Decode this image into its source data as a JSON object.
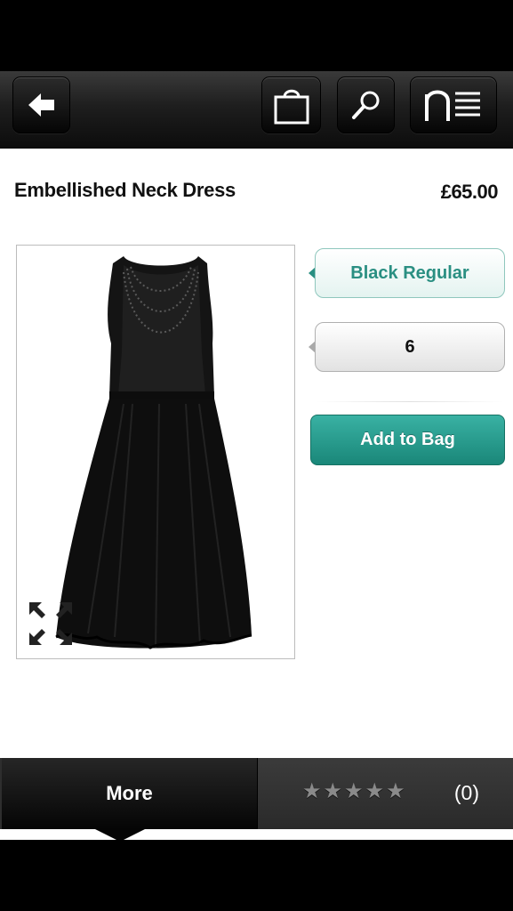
{
  "toolbar": {
    "back_icon": "arrow-left-icon",
    "bag_icon": "shopping-bag-icon",
    "search_icon": "magnifier-icon",
    "menu_icon": "brand-menu-icon",
    "menu_logo": "n"
  },
  "product": {
    "title": "Embellished Neck Dress",
    "price": "£65.00",
    "image_icon": "black-dress-image",
    "expand_icon": "expand-arrows-icon"
  },
  "options": {
    "colour": "Black Regular",
    "size": "6"
  },
  "actions": {
    "add_to_bag": "Add to Bag"
  },
  "tabs": {
    "more": "More",
    "rating_stars": 5,
    "rating_filled": 0,
    "review_count": "(0)"
  },
  "colors": {
    "accent": "#1a8779",
    "accent_text": "#2a8f82"
  }
}
